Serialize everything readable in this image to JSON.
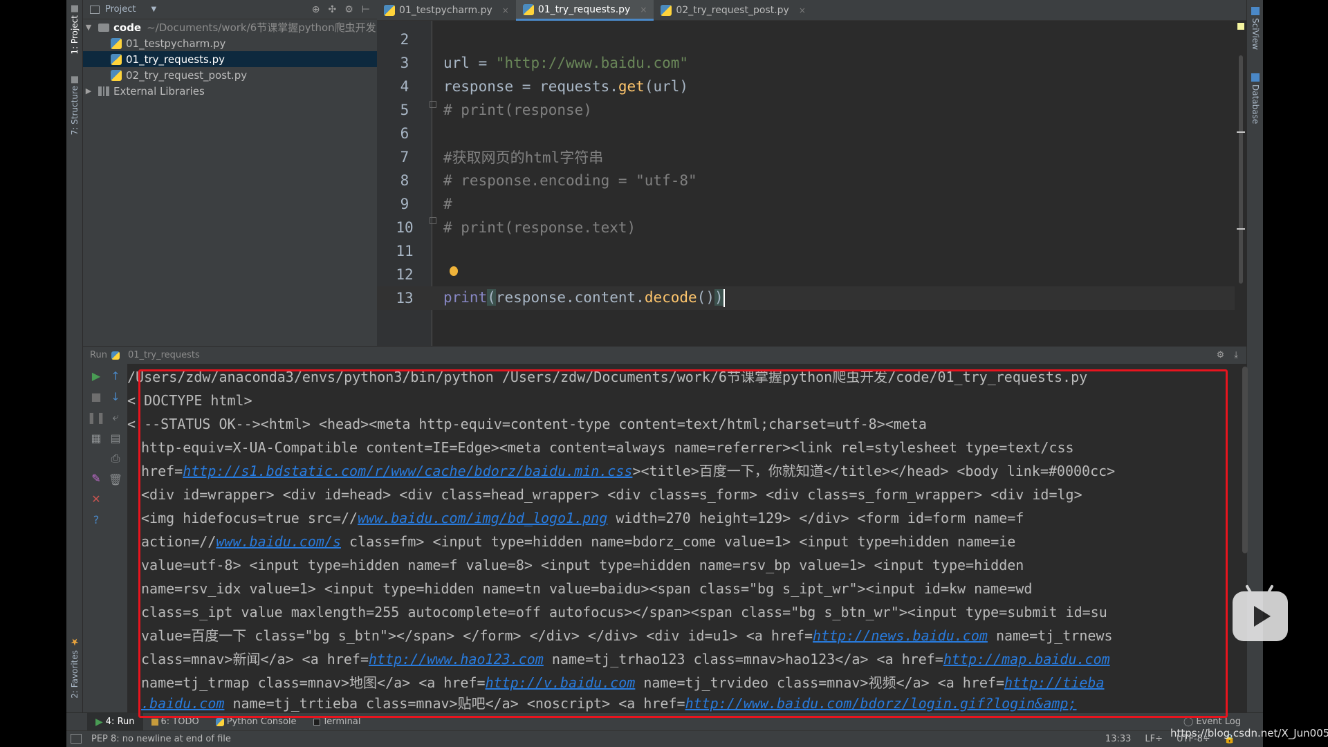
{
  "project_panel": {
    "title": "Project",
    "tree": [
      {
        "label": "code",
        "path": "~/Documents/work/6节课掌握python爬虫开发",
        "type": "folder"
      },
      {
        "label": "01_testpycharm.py",
        "type": "file"
      },
      {
        "label": "01_try_requests.py",
        "type": "file",
        "selected": true
      },
      {
        "label": "02_try_request_post.py",
        "type": "file"
      },
      {
        "label": "External Libraries",
        "type": "library"
      }
    ]
  },
  "left_strip": {
    "project_tab": "1: Project",
    "structure_tab": "7: Structure",
    "favorites_tab": "2: Favorites"
  },
  "right_strip": {
    "sciview_tab": "SciView",
    "database_tab": "Database"
  },
  "tabs": [
    {
      "label": "01_testpycharm.py"
    },
    {
      "label": "01_try_requests.py",
      "active": true
    },
    {
      "label": "02_try_request_post.py"
    }
  ],
  "editor": {
    "lines": [
      {
        "num": "2"
      },
      {
        "num": "3",
        "var": "url",
        "op": " = ",
        "str": "\"http://www.baidu.com\""
      },
      {
        "num": "4",
        "a": "response",
        "b": " = ",
        "c": "requests.",
        "d": "get",
        "e": "(url)"
      },
      {
        "num": "5",
        "comment": "# print(response)"
      },
      {
        "num": "6"
      },
      {
        "num": "7",
        "comment": "#获取网页的html字符串"
      },
      {
        "num": "8",
        "comment": "# response.encoding = \"utf-8\""
      },
      {
        "num": "9",
        "comment": "#"
      },
      {
        "num": "10",
        "comment": "# print(response.text)"
      },
      {
        "num": "11"
      },
      {
        "num": "12"
      },
      {
        "num": "13",
        "fn": "print",
        "open": "(",
        "mid": "response.content.",
        "call": "decode",
        "paren": "()",
        "close": ")"
      }
    ]
  },
  "run_panel": {
    "label": "Run",
    "config": "01_try_requests"
  },
  "console": {
    "l1": "/Users/zdw/anaconda3/envs/python3/bin/python /Users/zdw/Documents/work/6节课掌握python爬虫开发/code/01_try_requests.py",
    "l2": "<!DOCTYPE html>",
    "l3": "<!--STATUS OK--><html> <head><meta http-equiv=content-type content=text/html;charset=utf-8><meta",
    "l4": "http-equiv=X-UA-Compatible content=IE=Edge><meta content=always name=referrer><link rel=stylesheet type=text/css",
    "l5_a": "href=",
    "l5_link": "http://s1.bdstatic.com/r/www/cache/bdorz/baidu.min.css",
    "l5_b": "><title>百度一下，你就知道</title></head> <body link=#0000cc>",
    "l6": "<div id=wrapper> <div id=head> <div class=head_wrapper> <div class=s_form> <div class=s_form_wrapper> <div id=lg>",
    "l7_a": "<img hidefocus=true src=//",
    "l7_link": "www.baidu.com/img/bd_logo1.png",
    "l7_b": " width=270 height=129> </div> <form id=form name=f",
    "l8_a": "action=//",
    "l8_link": "www.baidu.com/s",
    "l8_b": " class=fm> <input type=hidden name=bdorz_come value=1> <input type=hidden name=ie",
    "l9": "value=utf-8> <input type=hidden name=f value=8> <input type=hidden name=rsv_bp value=1> <input type=hidden",
    "l10": "name=rsv_idx value=1> <input type=hidden name=tn value=baidu><span class=\"bg s_ipt_wr\"><input id=kw name=wd",
    "l11": "class=s_ipt value maxlength=255 autocomplete=off autofocus></span><span class=\"bg s_btn_wr\"><input type=submit id=su",
    "l12_a": "value=百度一下 class=\"bg s_btn\"></span> </form> </div> </div> <div id=u1> <a href=",
    "l12_link": "http://news.baidu.com",
    "l12_b": " name=tj_trnews",
    "l13_a": "class=mnav>新闻</a> <a href=",
    "l13_link1": "http://www.hao123.com",
    "l13_b": " name=tj_trhao123 class=mnav>hao123</a> <a href=",
    "l13_link2": "http://map.baidu.com",
    "l14_a": "name=tj_trmap class=mnav>地图</a> <a href=",
    "l14_link1": "http://v.baidu.com",
    "l14_b": " name=tj_trvideo class=mnav>视频</a> <a href=",
    "l14_link2": "http://tieba",
    "l15_link1": ".baidu.com",
    "l15_a": " name=tj_trtieba class=mnav>贴吧</a> <noscript> <a href=",
    "l15_link2": "http://www.baidu.com/bdorz/login.gif?login&amp;"
  },
  "bottom_tools": {
    "run": "4: Run",
    "todo": "6: TODO",
    "python_console": "Python Console",
    "terminal": "Terminal",
    "event_log": "Event Log"
  },
  "status_bar": {
    "message": "PEP 8: no newline at end of file",
    "position": "13:33",
    "line_sep": "LF÷",
    "encoding": "UTF-8÷"
  },
  "watermark": "https://blog.csdn.net/X_Jun005",
  "colors": {
    "accent": "#4a88c7",
    "highlight_box": "#e8141e",
    "link": "#287bde"
  }
}
